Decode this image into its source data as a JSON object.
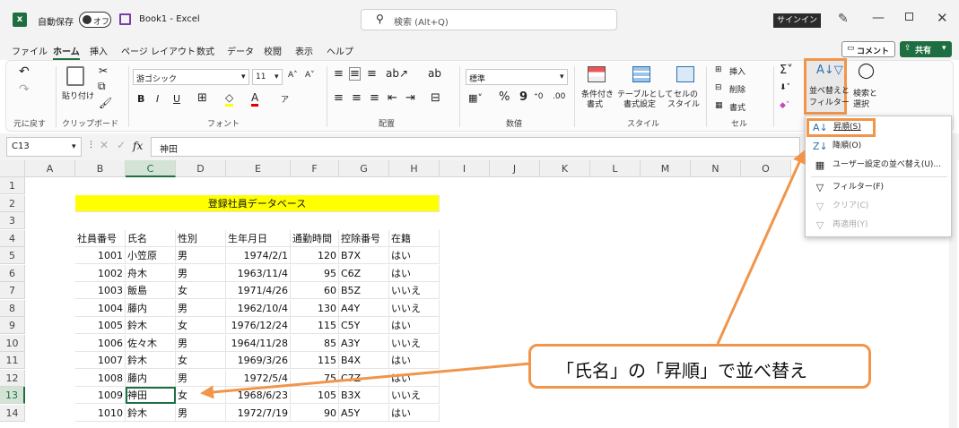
{
  "title_bar": {
    "autosave_label": "自動保存",
    "autosave_state": "オフ",
    "filename": "Book1 - Excel",
    "search_placeholder": "検索 (Alt+Q)",
    "signin": "サインイン"
  },
  "menu": {
    "tabs": [
      "ファイル",
      "ホーム",
      "挿入",
      "ページ レイアウト",
      "数式",
      "データ",
      "校閲",
      "表示",
      "ヘルプ"
    ],
    "comment": "コメント",
    "share": "共有"
  },
  "ribbon": {
    "undo": "元に戻す",
    "paste": "貼り付け",
    "clipboard": "クリップボード",
    "font_name": "游ゴシック",
    "font_size": "11",
    "font_group": "フォント",
    "align_group": "配置",
    "number_format": "標準",
    "number_group": "数値",
    "conditional": [
      "条件付き",
      "書式"
    ],
    "table_format": [
      "テーブルとして",
      "書式設定"
    ],
    "cell_style": [
      "セルの",
      "スタイル"
    ],
    "style_group": "スタイル",
    "insert": "挿入",
    "delete": "削除",
    "format": "書式",
    "cell_group": "セル",
    "sort_filter": [
      "並べ替えと",
      "フィルター"
    ],
    "find_select": [
      "検索と",
      "選択"
    ]
  },
  "formula_bar": {
    "name_box": "C13",
    "fx": "fx",
    "value": "神田"
  },
  "columns": [
    "A",
    "B",
    "C",
    "D",
    "E",
    "F",
    "G",
    "H",
    "I",
    "J",
    "K",
    "L",
    "M",
    "N",
    "O"
  ],
  "rows": [
    "1",
    "2",
    "3",
    "4",
    "5",
    "6",
    "7",
    "8",
    "9",
    "10",
    "11",
    "12",
    "13",
    "14"
  ],
  "sheet": {
    "title": "登録社員データベース",
    "headers": [
      "社員番号",
      "氏名",
      "性別",
      "生年月日",
      "通勤時間",
      "控除番号",
      "在籍"
    ],
    "records": [
      [
        "1001",
        "小笠原",
        "男",
        "1974/2/1",
        "120",
        "B7X",
        "はい"
      ],
      [
        "1002",
        "舟木",
        "男",
        "1963/11/4",
        "95",
        "C6Z",
        "はい"
      ],
      [
        "1003",
        "飯島",
        "女",
        "1971/4/26",
        "60",
        "B5Z",
        "いいえ"
      ],
      [
        "1004",
        "藤内",
        "男",
        "1962/10/4",
        "130",
        "A4Y",
        "いいえ"
      ],
      [
        "1005",
        "鈴木",
        "女",
        "1976/12/24",
        "115",
        "C5Y",
        "はい"
      ],
      [
        "1006",
        "佐々木",
        "男",
        "1964/11/28",
        "85",
        "A3Y",
        "いいえ"
      ],
      [
        "1007",
        "鈴木",
        "女",
        "1969/3/26",
        "115",
        "B4X",
        "はい"
      ],
      [
        "1008",
        "藤内",
        "男",
        "1972/5/4",
        "75",
        "C7Z",
        "はい"
      ],
      [
        "1009",
        "神田",
        "女",
        "1968/6/23",
        "105",
        "B3X",
        "いいえ"
      ],
      [
        "1010",
        "鈴木",
        "男",
        "1972/7/19",
        "90",
        "A5Y",
        "はい"
      ]
    ]
  },
  "sort_menu": {
    "ascending": "昇順(S)",
    "descending": "降順(O)",
    "custom": "ユーザー設定の並べ替え(U)...",
    "filter": "フィルター(F)",
    "clear": "クリア(C)",
    "reapply": "再適用(Y)"
  },
  "callout": {
    "text": "「氏名」の「昇順」で並べ替え",
    "color": "#f0954a"
  }
}
